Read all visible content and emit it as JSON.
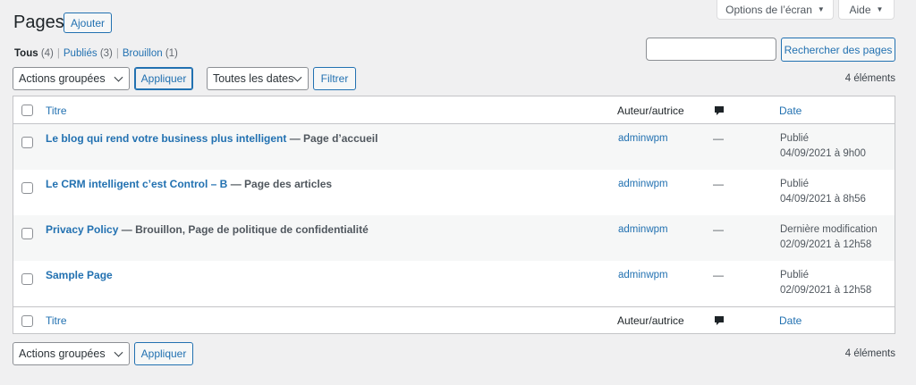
{
  "screen_options": {
    "label": "Options de l’écran"
  },
  "help": {
    "label": "Aide"
  },
  "page": {
    "title": "Pages",
    "add_new": "Ajouter"
  },
  "filters": {
    "all": {
      "label": "Tous",
      "count": "(4)"
    },
    "published": {
      "label": "Publiés",
      "count": "(3)"
    },
    "draft": {
      "label": "Brouillon",
      "count": "(1)"
    },
    "separator": "|"
  },
  "search": {
    "value": "",
    "button": "Rechercher des pages"
  },
  "top_nav": {
    "bulk_actions": "Actions groupées",
    "apply": "Appliquer",
    "dates": "Toutes les dates",
    "filter": "Filtrer",
    "count": "4 éléments"
  },
  "columns": {
    "title": "Titre",
    "author": "Auteur/autrice",
    "date": "Date"
  },
  "rows": [
    {
      "title": "Le blog qui rend votre business plus intelligent",
      "state": "— Page d’accueil",
      "author": "adminwpm",
      "comments": "—",
      "status": "Publié",
      "date": "04/09/2021 à 9h00"
    },
    {
      "title": "Le CRM intelligent c’est Control – B",
      "state": "— Page des articles",
      "author": "adminwpm",
      "comments": "—",
      "status": "Publié",
      "date": "04/09/2021 à 8h56"
    },
    {
      "title": "Privacy Policy",
      "state": "— Brouillon, Page de politique de confidentialité",
      "author": "adminwpm",
      "comments": "—",
      "status": "Dernière modification",
      "date": "02/09/2021 à 12h58"
    },
    {
      "title": "Sample Page",
      "state": "",
      "author": "adminwpm",
      "comments": "—",
      "status": "Publié",
      "date": "02/09/2021 à 12h58"
    }
  ],
  "bottom_nav": {
    "bulk_actions": "Actions groupées",
    "apply": "Appliquer",
    "count": "4 éléments"
  },
  "colors": {
    "link": "#2271b1",
    "background": "#f0f0f1",
    "row_alt": "#f6f7f7"
  }
}
